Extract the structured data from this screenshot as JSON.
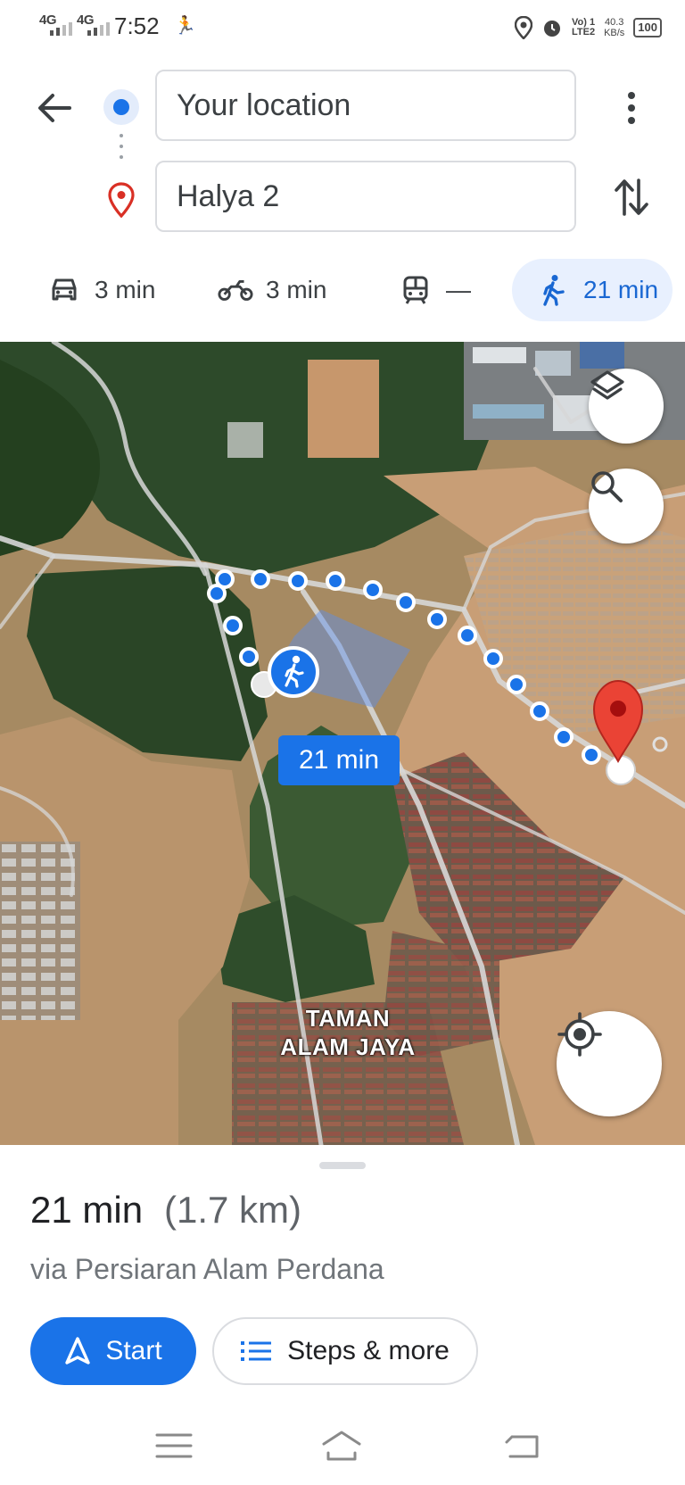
{
  "status_bar": {
    "network1": "4G",
    "network2": "4G",
    "time": "7:52",
    "volte_line1": "Vo) 1",
    "volte_line2": "LTE2",
    "speed_value": "40.3",
    "speed_unit": "KB/s",
    "battery": "100"
  },
  "directions": {
    "origin": "Your location",
    "destination": "Halya 2"
  },
  "travel_modes": [
    {
      "mode": "car-icon",
      "time": "3 min"
    },
    {
      "mode": "motorcycle-icon",
      "time": "3 min"
    },
    {
      "mode": "transit-icon",
      "time": "—"
    },
    {
      "mode": "walk-icon",
      "time": "21 min",
      "selected": true
    }
  ],
  "map": {
    "route_chip": "21 min",
    "place_line1": "TAMAN",
    "place_line2": "ALAM JAYA"
  },
  "summary": {
    "duration": "21 min",
    "distance": "(1.7 km)",
    "via": "via Persiaran Alam Perdana",
    "start_label": "Start",
    "steps_label": "Steps & more"
  },
  "colors": {
    "accent": "#1a73e8",
    "selected_mode_bg": "#e8f0fe",
    "destination_pin": "#ea4335"
  }
}
